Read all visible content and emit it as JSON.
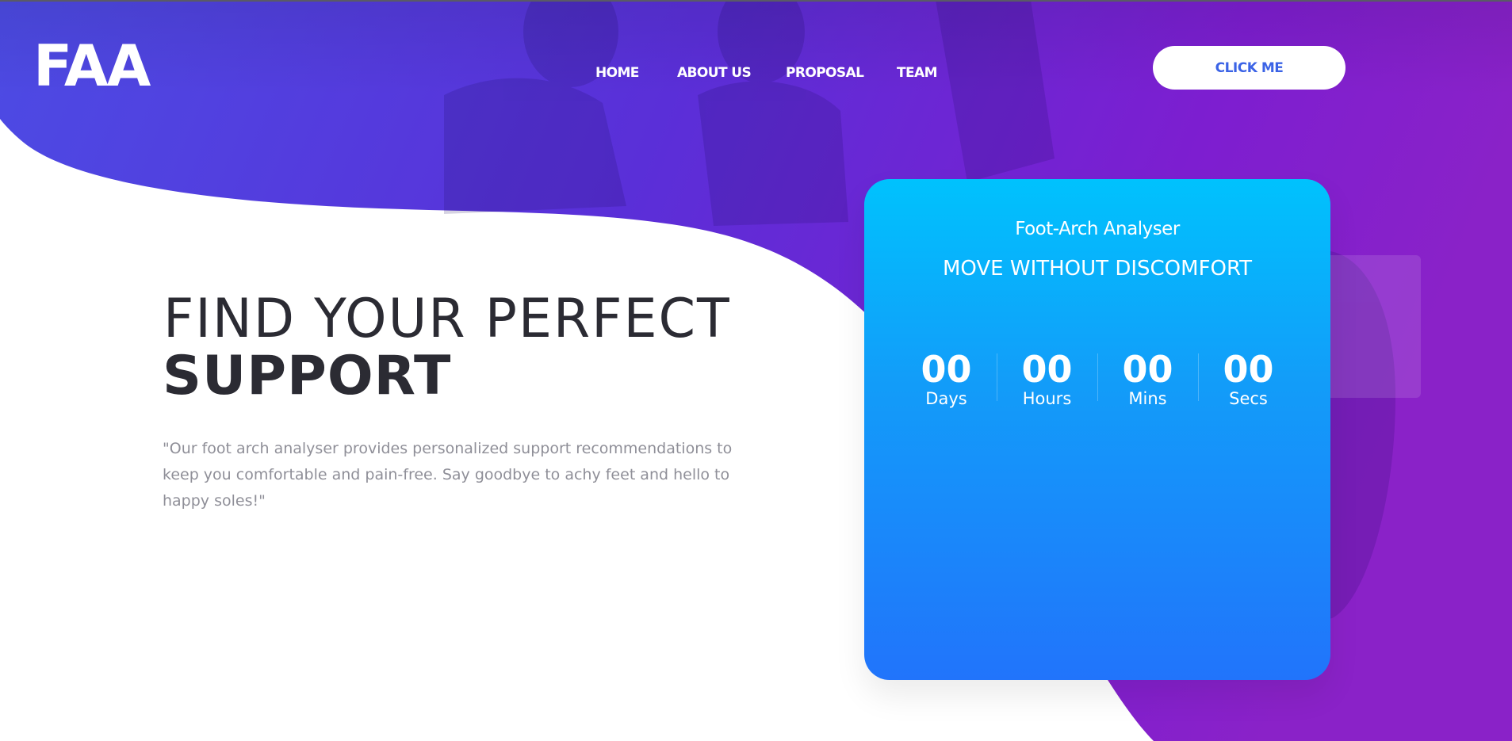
{
  "brand": {
    "logo_text": "FAA"
  },
  "nav": {
    "items": [
      {
        "label": "HOME"
      },
      {
        "label": "ABOUT US"
      },
      {
        "label": "PROPOSAL"
      },
      {
        "label": "TEAM"
      }
    ]
  },
  "cta": {
    "label": "CLICK ME"
  },
  "hero": {
    "headline_light": "FIND YOUR PERFECT",
    "headline_bold": "SUPPORT",
    "description": "\"Our foot arch analyser provides personalized support recommendations to keep you comfortable and pain-free. Say goodbye to achy feet and hello to happy soles!\""
  },
  "card": {
    "title": "Foot-Arch Analyser",
    "subtitle": "MOVE WITHOUT DISCOMFORT",
    "countdown": [
      {
        "value": "00",
        "label": "Days"
      },
      {
        "value": "00",
        "label": "Hours"
      },
      {
        "value": "00",
        "label": "Mins"
      },
      {
        "value": "00",
        "label": "Secs"
      }
    ]
  },
  "colors": {
    "hero_gradient_start": "#4a45e0",
    "hero_gradient_end": "#8a1ccb",
    "card_gradient_start": "#00c2fd",
    "card_gradient_end": "#2174fb",
    "cta_text": "#3b63e6",
    "headline_text": "#2b2b33",
    "description_text": "#8f8f98"
  }
}
